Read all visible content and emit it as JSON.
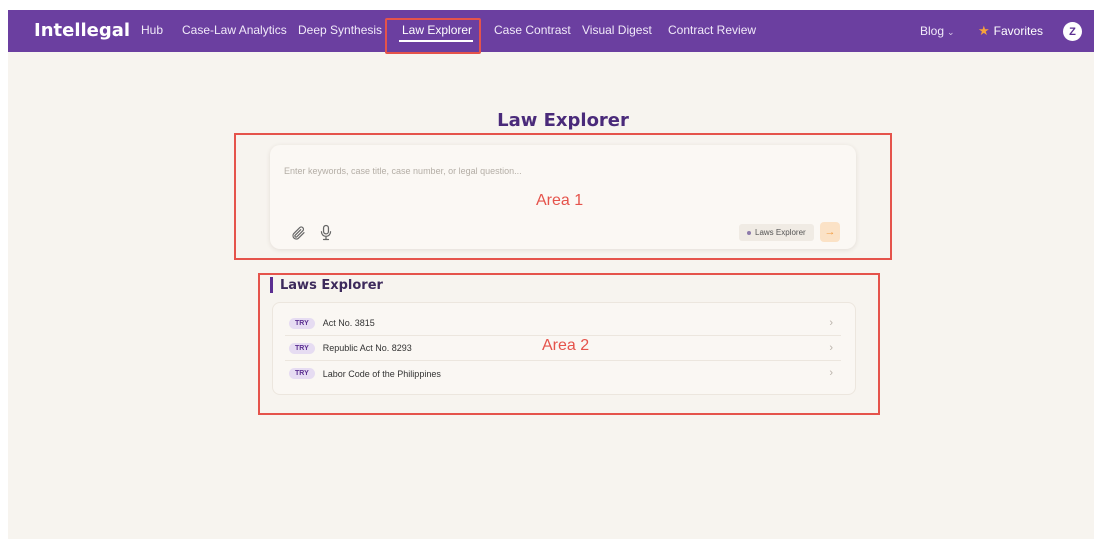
{
  "brand": "Intellegal",
  "nav": {
    "items": [
      {
        "label": "Hub"
      },
      {
        "label": "Case-Law Analytics"
      },
      {
        "label": "Deep Synthesis"
      },
      {
        "label": "Law Explorer"
      },
      {
        "label": "Case Contrast"
      },
      {
        "label": "Visual Digest"
      },
      {
        "label": "Contract Review"
      }
    ],
    "active": "Law Explorer",
    "blog": "Blog",
    "favorites": "Favorites",
    "avatar_initial": "Z"
  },
  "page_title": "Law Explorer",
  "search": {
    "placeholder": "Enter keywords, case title, case number, or legal question...",
    "value": "",
    "mode_chip": "Laws Explorer",
    "send_icon": "arrow-right-icon",
    "attach_icon": "paperclip-icon",
    "mic_icon": "microphone-icon"
  },
  "annotations": {
    "area1": "Area 1",
    "area2": "Area 2"
  },
  "laws": {
    "title": "Laws Explorer",
    "badge": "TRY",
    "items": [
      {
        "label": "Act No. 3815"
      },
      {
        "label": "Republic Act No. 8293"
      },
      {
        "label": "Labor Code of the Philippines"
      }
    ]
  },
  "colors": {
    "nav_bg": "#6b3fa0",
    "accent_purple": "#5b2e91",
    "annotation_red": "#e5534b",
    "send_orange": "#f19a3e",
    "page_bg": "#f7f4ef"
  }
}
